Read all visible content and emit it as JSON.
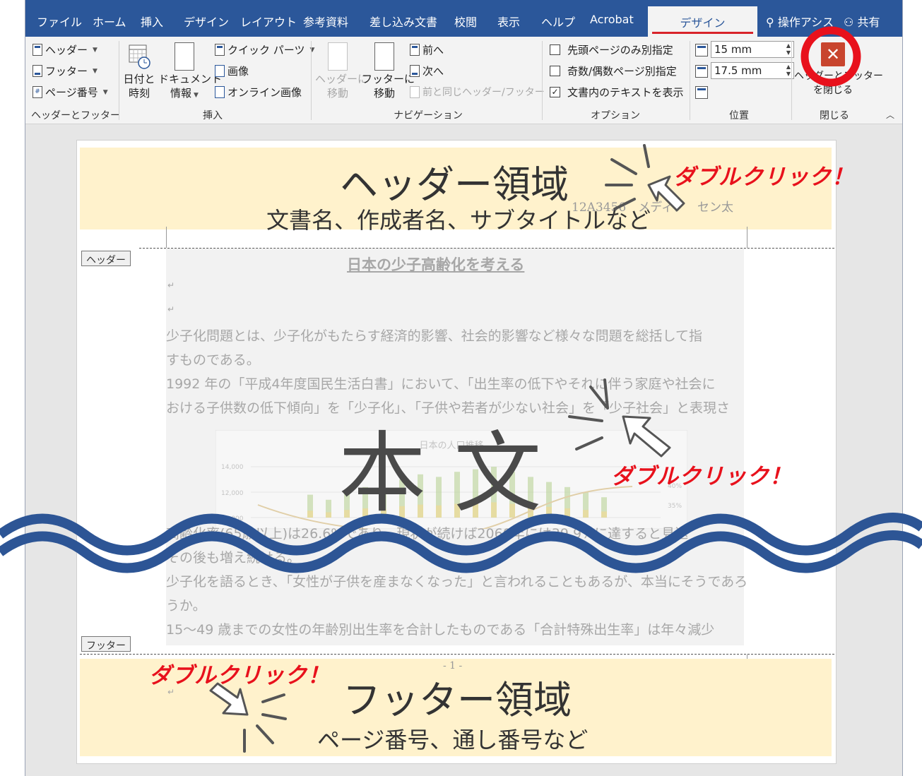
{
  "tabs": [
    "ファイル",
    "ホーム",
    "挿入",
    "デザイン",
    "レイアウト",
    "参考資料",
    "差し込み文書",
    "校閲",
    "表示",
    "ヘルプ",
    "Acrobat"
  ],
  "active_tab": "デザイン",
  "tell_me": "操作アシス",
  "share": "共有",
  "ribbon": {
    "hf_group": {
      "header": "ヘッダー",
      "footer": "フッター",
      "page_number": "ページ番号",
      "label": "ヘッダーとフッター"
    },
    "insert_group": {
      "date_time": [
        "日付と",
        "時刻"
      ],
      "doc_info": [
        "ドキュメント",
        "情報"
      ],
      "quick_parts": "クイック パーツ",
      "picture": "画像",
      "online_picture": "オンライン画像",
      "label": "挿入"
    },
    "nav_group": {
      "goto_header": [
        "ヘッダーに",
        "移動"
      ],
      "goto_footer": [
        "フッターに",
        "移動"
      ],
      "prev": "前へ",
      "next": "次へ",
      "link_prev": "前と同じヘッダー/フッター",
      "label": "ナビゲーション"
    },
    "options_group": {
      "first_page": "先頭ページのみ別指定",
      "odd_even": "奇数/偶数ページ別指定",
      "show_text": "文書内のテキストを表示",
      "first_page_checked": false,
      "odd_even_checked": false,
      "show_text_checked": true,
      "label": "オプション"
    },
    "position_group": {
      "header_from_top": "15 mm",
      "footer_from_bottom": "17.5 mm",
      "label": "位置"
    },
    "close_group": {
      "close_label_1": "ヘッダーとフッター",
      "close_label_2": "を閉じる",
      "label": "閉じる"
    }
  },
  "document": {
    "header_region_title": "ヘッダー領域",
    "header_region_sub": "文書名、作成者名、サブタイトルなど",
    "header_faint_text": "12A3456　メディア　セン太",
    "header_tag": "ヘッダー",
    "doc_title": "日本の少子高齢化を考える",
    "body_lines": [
      "少子化問題とは、少子化がもたらす経済的影響、社会的影響など様々な問題を総括して指",
      "すものである。",
      "1992  年の「平成4年度国民生活白書」において、「出生率の低下やそれに伴う家庭や社会に",
      "おける子供数の低下傾向」を「少子化」、「子供や若者が少ない社会」を「少子社会」と表現さ"
    ],
    "body_label": "本 文",
    "lower_lines": [
      "高齢化率(65歳以上)は26.6%であり、現状が続けば2060年には39.9%に達すると見込",
      "その後も増え続ける。",
      "少子化を語るとき、「女性が子供を産まなくなった」と言われることもあるが、本当にそうであろ",
      "うか。",
      "15～49  歳までの女性の年齢別出生率を合計したものである「合計特殊出生率」は年々減少"
    ],
    "footer_tag": "フッター",
    "footer_page_no": "- 1 -",
    "footer_region_title": "フッター領域",
    "footer_region_sub": "ページ番号、通し番号など",
    "double_click": "ダブルクリック！"
  },
  "chart_data": {
    "type": "bar",
    "title": "日本の人口推移",
    "y_ticks": [
      "14,000",
      "12,000",
      "10,000"
    ],
    "y2_ticks": [
      "40%",
      "35%"
    ],
    "values": [
      0.45,
      0.35,
      0.5,
      0.6,
      0.55,
      0.75,
      0.85,
      0.8,
      0.9,
      0.95,
      1.0,
      0.9,
      0.8,
      0.7,
      0.6,
      0.5,
      0.4
    ],
    "accent_color": "#b5cf8e"
  },
  "colors": {
    "ribbon_blue": "#2b579a",
    "highlight": "#fff2cc",
    "red": "#e8111c",
    "wave": "#2d5595",
    "close_button": "#c8452e"
  }
}
